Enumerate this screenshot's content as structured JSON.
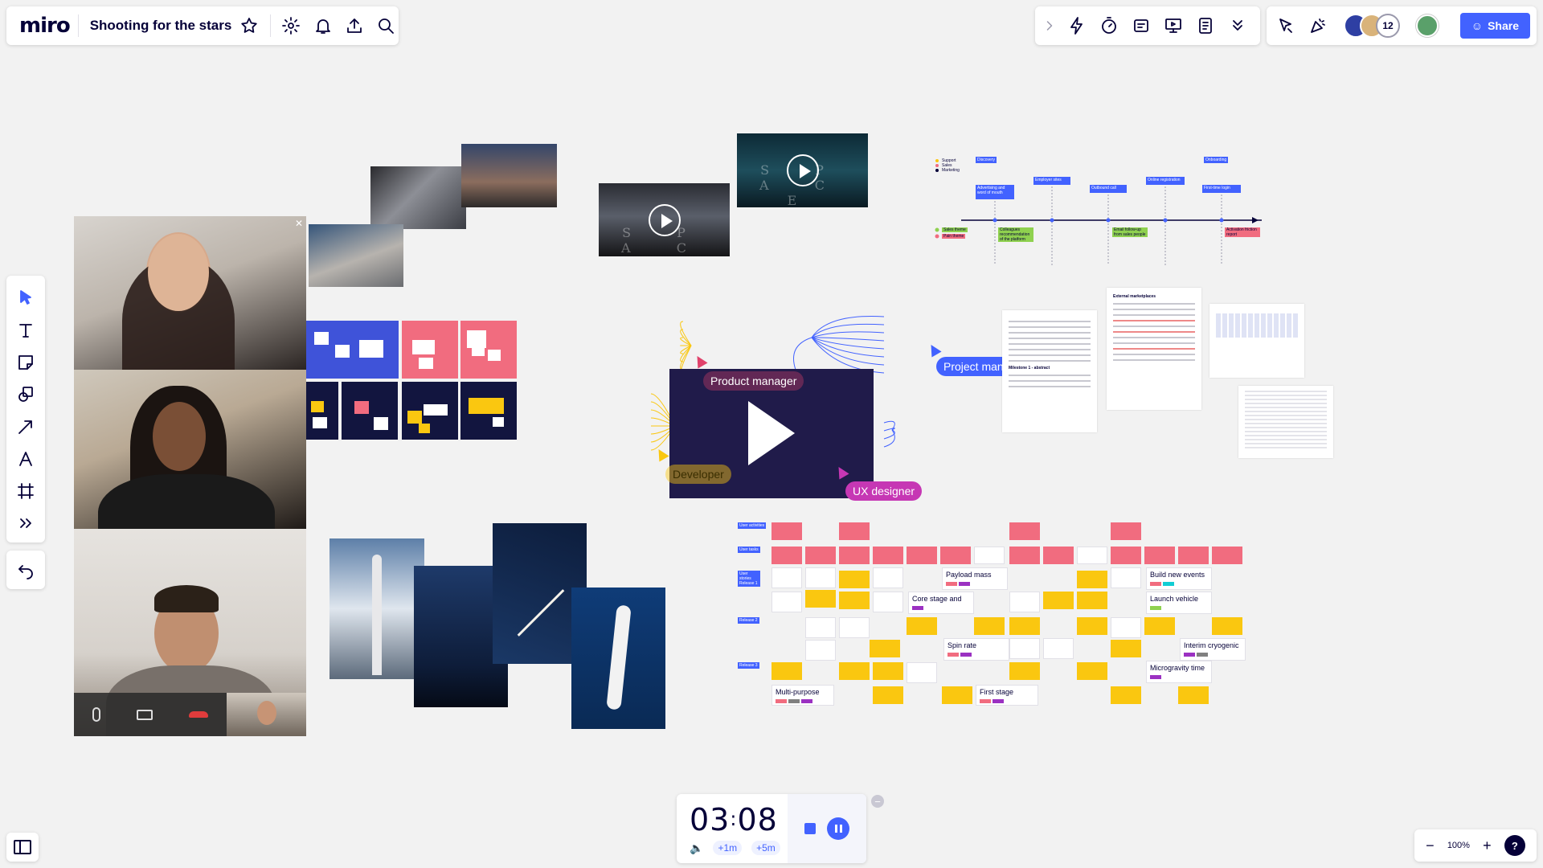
{
  "app": {
    "logo": "miro",
    "board_title": "Shooting for the stars"
  },
  "topbar": {
    "icons": [
      "star-icon",
      "gear-icon",
      "bell-icon",
      "upload-icon",
      "search-icon"
    ]
  },
  "collab_toolbar": {
    "icons": [
      "chevron-right-icon",
      "lightning-icon",
      "timer-icon",
      "card-icon",
      "present-icon",
      "notes-icon",
      "more-icon"
    ]
  },
  "share_bar": {
    "participant_count": "12",
    "share_label": "Share"
  },
  "left_toolbar": {
    "tools": [
      "select-icon",
      "text-icon",
      "sticky-note-icon",
      "shapes-icon",
      "arrow-icon",
      "pen-icon",
      "frame-icon",
      "more-tools-icon"
    ]
  },
  "timer": {
    "minutes": "03",
    "seconds": "08",
    "add_1": "+1m",
    "add_5": "+5m"
  },
  "zoom": {
    "value": "100%",
    "help": "?"
  },
  "video_titles": {
    "left": "S P A C E",
    "right": "S P A C E"
  },
  "cursors": [
    {
      "label": "Project manager",
      "color": "#4262ff"
    },
    {
      "label": "Product manager",
      "color": "#e0426b"
    },
    {
      "label": "Developer",
      "color": "#fac710"
    },
    {
      "label": "UX designer",
      "color": "#c637b4"
    }
  ],
  "timeline": {
    "legend": [
      "Support",
      "Sales",
      "Marketing"
    ],
    "phases": [
      "Discovery",
      "Onboarding"
    ],
    "steps": [
      "Advertising and word of mouth",
      "Employer sites",
      "Outbound call",
      "Online registration",
      "First-time login"
    ],
    "notes": [
      "Sales theme",
      "Pain theme",
      "Colleagues recommendation of the platform",
      "Email follow-up from sales people",
      "Activation friction report"
    ]
  },
  "docs": {
    "doc2_title": "External marketplaces",
    "doc1_heading": "Milestone 1 - abstract"
  },
  "story_map": {
    "row_labels": [
      "User activities",
      "User tasks",
      "User stories Release 1",
      "Release 2",
      "Release 3"
    ],
    "cards": [
      "Payload mass",
      "Build new events",
      "Core stage and",
      "Launch vehicle",
      "Spin rate",
      "Interim cryogenic",
      "Microgravity time",
      "Multi-purpose",
      "First stage"
    ]
  },
  "colors": {
    "accent": "#4262ff",
    "sticky_red": "#f16c7f",
    "sticky_yellow": "#fac710",
    "navy_sticky": "#12153f"
  }
}
